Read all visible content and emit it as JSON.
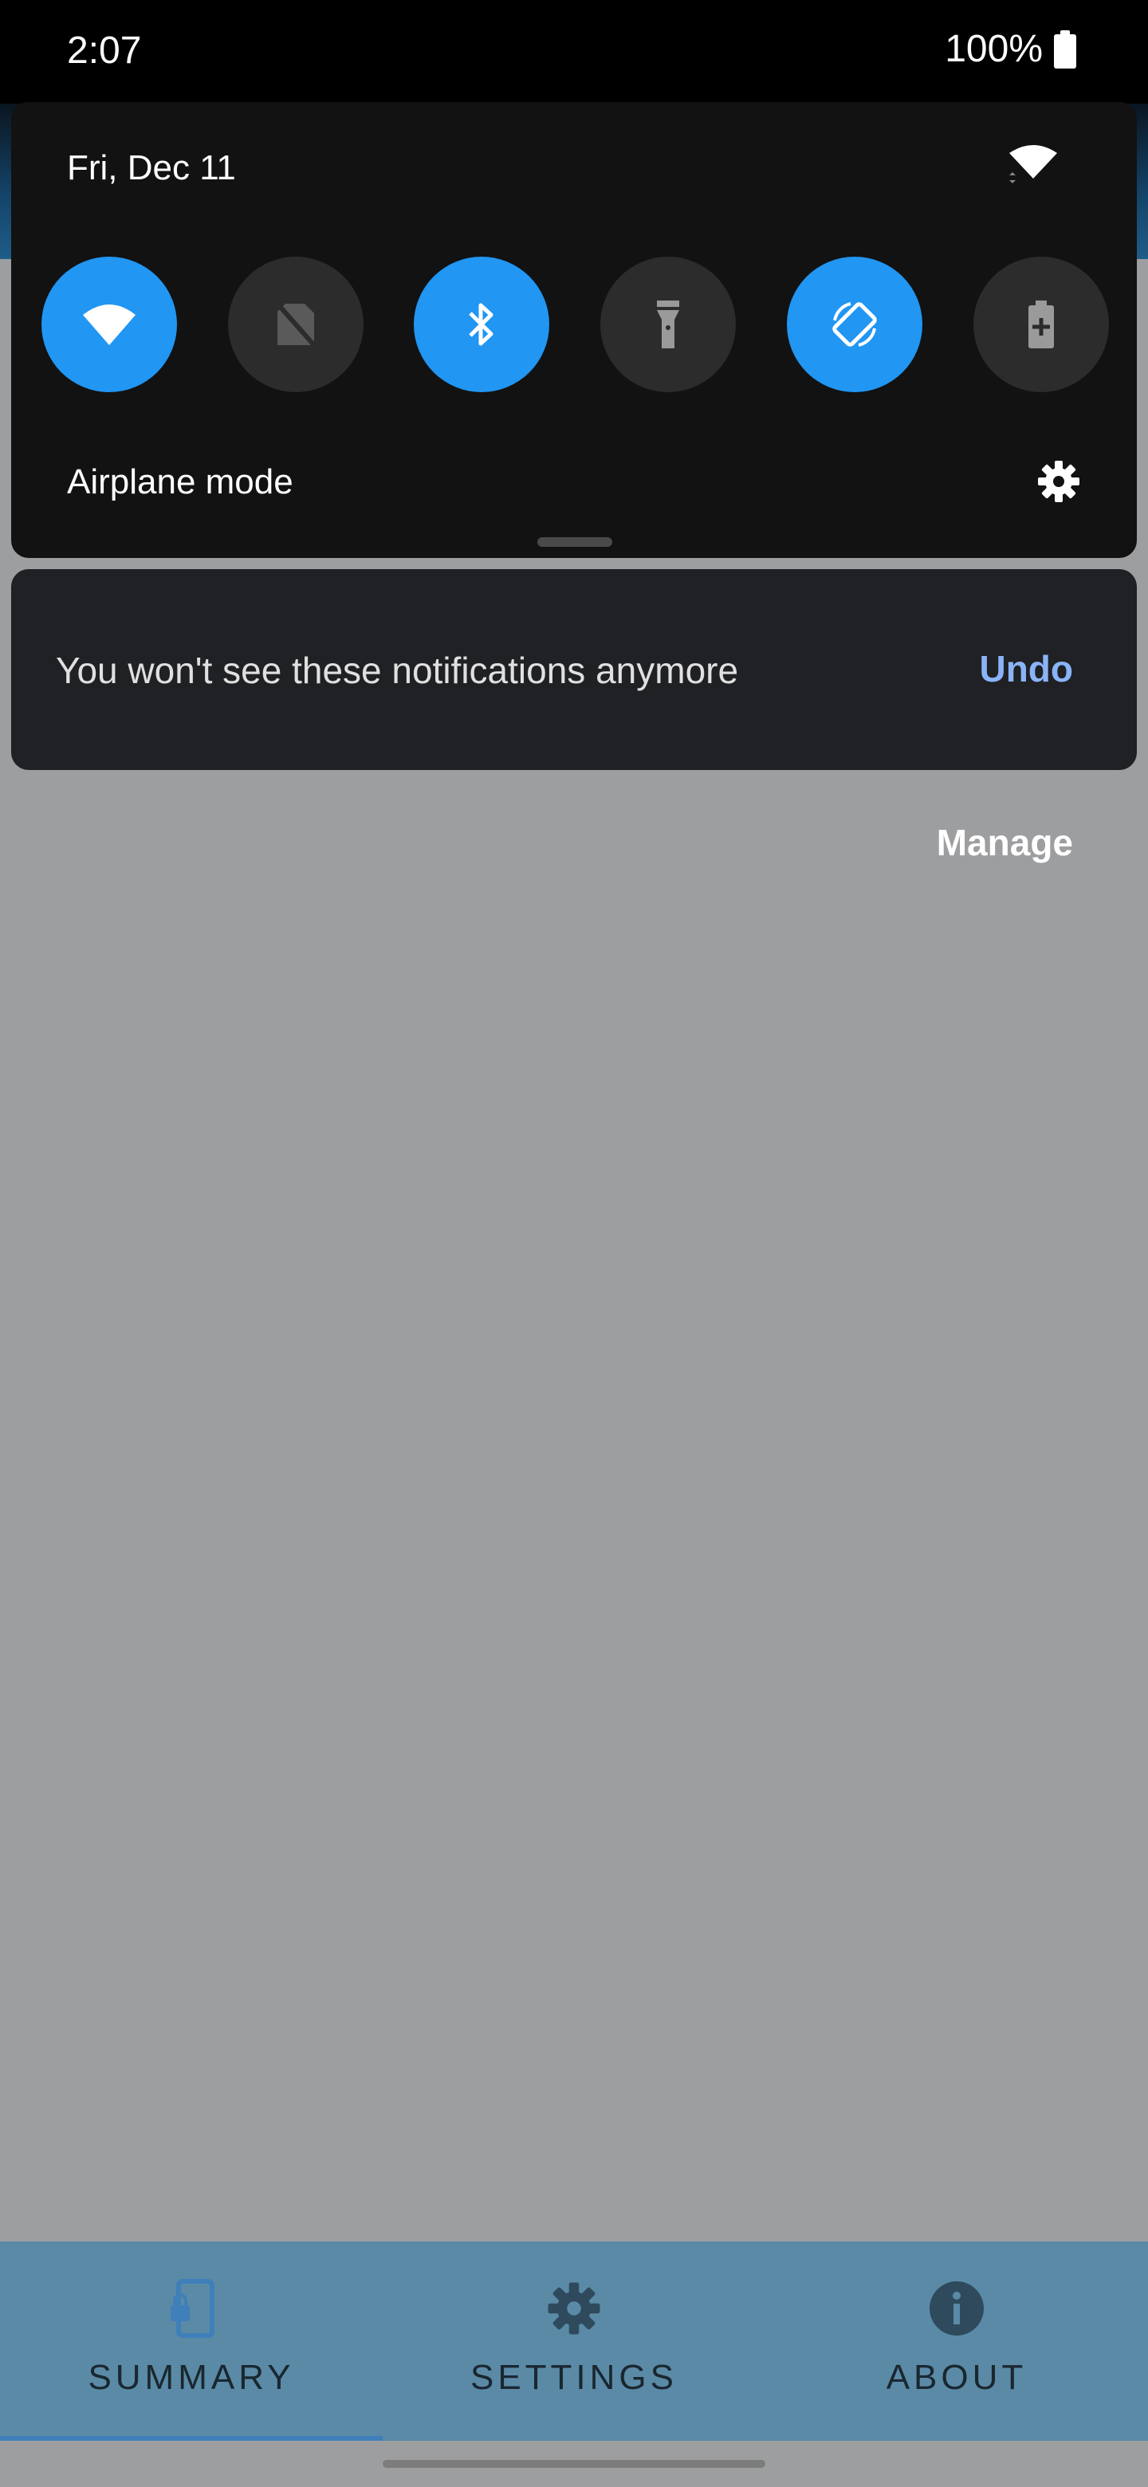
{
  "status_bar": {
    "time": "2:07",
    "battery": "100%"
  },
  "quick_settings": {
    "date": "Fri, Dec 11",
    "tiles": [
      {
        "name": "wifi",
        "icon": "wifi-icon",
        "state": "on"
      },
      {
        "name": "sim",
        "icon": "no-sim-icon",
        "state": "off"
      },
      {
        "name": "bluetooth",
        "icon": "bluetooth-icon",
        "state": "on"
      },
      {
        "name": "flashlight",
        "icon": "flashlight-icon",
        "state": "off"
      },
      {
        "name": "auto-rotate",
        "icon": "auto-rotate-icon",
        "state": "on"
      },
      {
        "name": "battery-saver",
        "icon": "battery-saver-icon",
        "state": "off"
      }
    ],
    "tile_label": "Airplane mode"
  },
  "notification": {
    "message": "You won't see these notifications anymore",
    "undo_label": "Undo"
  },
  "manage_label": "Manage",
  "bottom_nav": {
    "items": [
      {
        "label": "SUMMARY",
        "icon": "phone-lock-icon",
        "active": true
      },
      {
        "label": "SETTINGS",
        "icon": "gear-icon",
        "active": false
      },
      {
        "label": "ABOUT",
        "icon": "info-icon",
        "active": false
      }
    ]
  },
  "colors": {
    "accent": "#2196f3",
    "tile_off": "#2c2c2c",
    "panel": "#121212",
    "card": "#202124",
    "undo": "#8ab4f8",
    "scrim": "#9d9ea0",
    "nav_bg": "#5a8aa6",
    "nav_indicator": "#3f7fba"
  }
}
